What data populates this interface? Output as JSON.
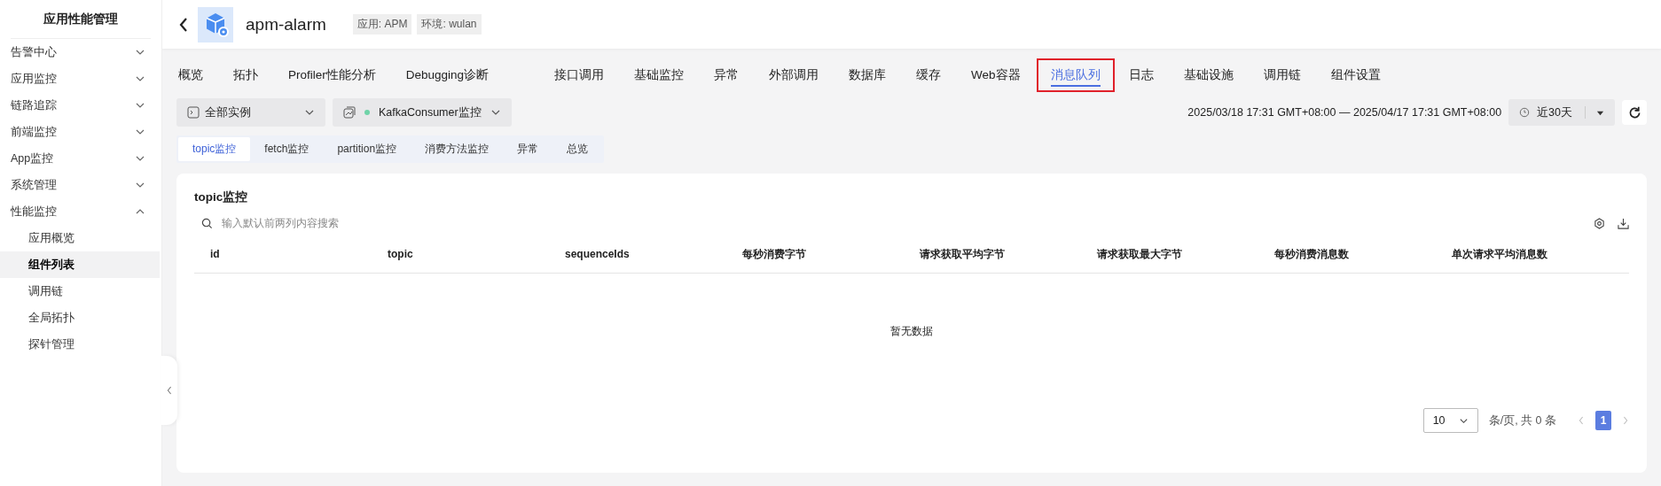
{
  "sidebar": {
    "title": "应用性能管理",
    "items": [
      {
        "label": "告警中心",
        "expanded": false
      },
      {
        "label": "应用监控",
        "expanded": false
      },
      {
        "label": "链路追踪",
        "expanded": false
      },
      {
        "label": "前端监控",
        "expanded": false
      },
      {
        "label": "App监控",
        "expanded": false
      },
      {
        "label": "系统管理",
        "expanded": false
      },
      {
        "label": "性能监控",
        "expanded": true,
        "children": [
          {
            "label": "应用概览",
            "selected": false
          },
          {
            "label": "组件列表",
            "selected": true
          },
          {
            "label": "调用链",
            "selected": false
          },
          {
            "label": "全局拓扑",
            "selected": false
          },
          {
            "label": "探针管理",
            "selected": false
          }
        ]
      }
    ]
  },
  "header": {
    "title": "apm-alarm",
    "tags": [
      "应用: APM",
      "环境: wulan"
    ]
  },
  "tabs": [
    {
      "label": "概览",
      "selected": false,
      "gap_before": false,
      "highlighted": false
    },
    {
      "label": "拓扑",
      "selected": false,
      "gap_before": false,
      "highlighted": false
    },
    {
      "label": "Profiler性能分析",
      "selected": false,
      "gap_before": false,
      "highlighted": false
    },
    {
      "label": "Debugging诊断",
      "selected": false,
      "gap_before": false,
      "highlighted": false
    },
    {
      "label": "接口调用",
      "selected": false,
      "gap_before": true,
      "highlighted": false
    },
    {
      "label": "基础监控",
      "selected": false,
      "gap_before": false,
      "highlighted": false
    },
    {
      "label": "异常",
      "selected": false,
      "gap_before": false,
      "highlighted": false
    },
    {
      "label": "外部调用",
      "selected": false,
      "gap_before": false,
      "highlighted": false
    },
    {
      "label": "数据库",
      "selected": false,
      "gap_before": false,
      "highlighted": false
    },
    {
      "label": "缓存",
      "selected": false,
      "gap_before": false,
      "highlighted": false
    },
    {
      "label": "Web容器",
      "selected": false,
      "gap_before": false,
      "highlighted": false
    },
    {
      "label": "消息队列",
      "selected": true,
      "gap_before": false,
      "highlighted": true
    },
    {
      "label": "日志",
      "selected": false,
      "gap_before": false,
      "highlighted": false
    },
    {
      "label": "基础设施",
      "selected": false,
      "gap_before": false,
      "highlighted": false
    },
    {
      "label": "调用链",
      "selected": false,
      "gap_before": false,
      "highlighted": false
    },
    {
      "label": "组件设置",
      "selected": false,
      "gap_before": false,
      "highlighted": false
    }
  ],
  "filters": {
    "instance": "全部实例",
    "monitor": "KafkaConsumer监控",
    "time_range": "2025/03/18 17:31 GMT+08:00 — 2025/04/17 17:31 GMT+08:00",
    "quick_range": "近30天"
  },
  "subtabs": [
    {
      "label": "topic监控",
      "selected": true
    },
    {
      "label": "fetch监控",
      "selected": false
    },
    {
      "label": "partition监控",
      "selected": false
    },
    {
      "label": "消费方法监控",
      "selected": false
    },
    {
      "label": "异常",
      "selected": false
    },
    {
      "label": "总览",
      "selected": false
    }
  ],
  "table": {
    "title": "topic监控",
    "search_placeholder": "输入默认前两列内容搜索",
    "columns": [
      "id",
      "topic",
      "sequenceIds",
      "每秒消费字节",
      "请求获取平均字节",
      "请求获取最大字节",
      "每秒消费消息数",
      "单次请求平均消息数"
    ],
    "empty_text": "暂无数据"
  },
  "pagination": {
    "page_size": "10",
    "summary": "条/页, 共 0 条",
    "pages": [
      {
        "label": "1",
        "selected": true
      }
    ]
  }
}
